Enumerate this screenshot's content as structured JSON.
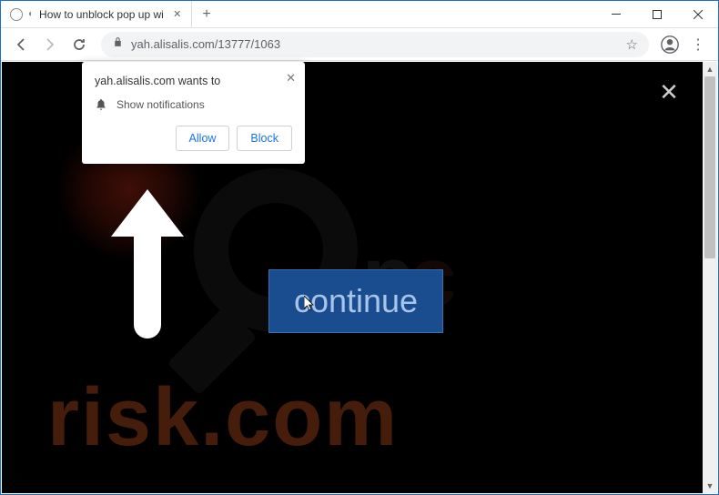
{
  "tab": {
    "title": "How to unblock pop up windo"
  },
  "url": "yah.alisalis.com/13777/1063",
  "notification": {
    "origin": "yah.alisalis.com wants to",
    "permission": "Show notifications",
    "allow": "Allow",
    "block": "Block"
  },
  "page": {
    "continue": "continue"
  },
  "watermark": {
    "p": "p",
    "c": "c",
    "risk": "risk.com"
  }
}
